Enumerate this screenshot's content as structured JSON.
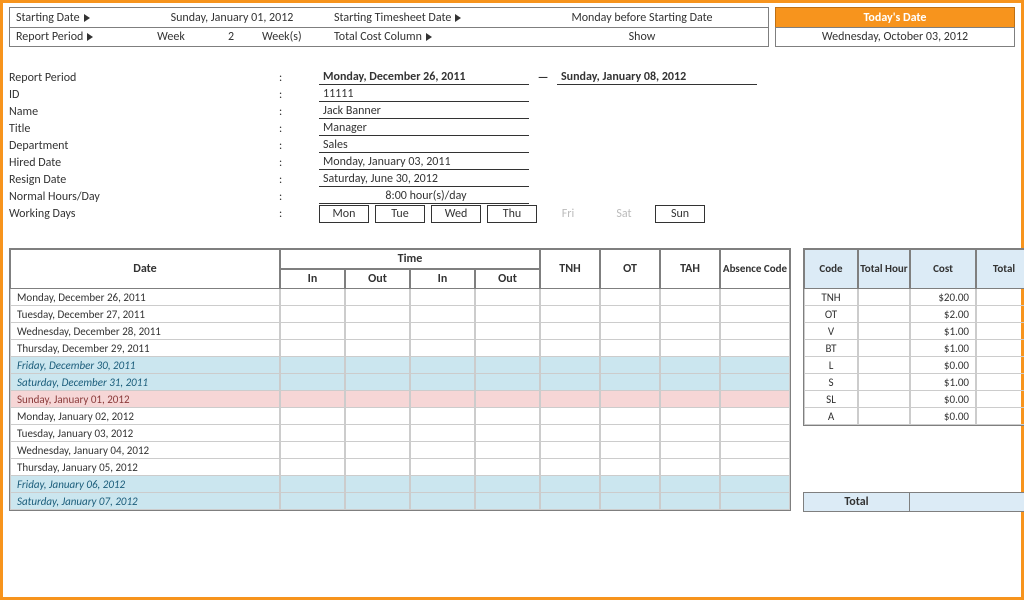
{
  "header": {
    "starting_date_label": "Starting Date",
    "starting_date_value": "Sunday, January 01, 2012",
    "ts_date_label": "Starting Timesheet Date",
    "ts_date_value": "Monday before Starting Date",
    "report_period_label": "Report Period",
    "week_label": "Week",
    "week_num": "2",
    "weeks_label": "Week(s)",
    "total_cost_label": "Total Cost Column",
    "show_label": "Show",
    "todays_date_label": "Today's Date",
    "todays_date_value": "Wednesday, October 03, 2012"
  },
  "info": {
    "report_period_label": "Report Period",
    "report_period_from": "Monday, December 26, 2011",
    "report_period_to": "Sunday, January 08, 2012",
    "id_label": "ID",
    "id_value": "11111",
    "name_label": "Name",
    "name_value": "Jack Banner",
    "title_label": "Title",
    "title_value": "Manager",
    "dept_label": "Department",
    "dept_value": "Sales",
    "hired_label": "Hired Date",
    "hired_value": "Monday, January 03, 2011",
    "resign_label": "Resign Date",
    "resign_value": "Saturday, June 30, 2012",
    "hours_label": "Normal Hours/Day",
    "hours_value": "8:00    hour(s)/day",
    "working_days_label": "Working Days",
    "days": [
      "Mon",
      "Tue",
      "Wed",
      "Thu",
      "Fri",
      "Sat",
      "Sun"
    ],
    "days_off_idx": [
      4,
      5
    ]
  },
  "timesheet": {
    "headers": {
      "date": "Date",
      "time": "Time",
      "in": "In",
      "out": "Out",
      "tnh": "TNH",
      "ot": "OT",
      "tah": "TAH",
      "absence": "Absence Code"
    },
    "rows": [
      {
        "date": "Monday, December 26, 2011",
        "cls": ""
      },
      {
        "date": "Tuesday, December 27, 2011",
        "cls": ""
      },
      {
        "date": "Wednesday, December 28, 2011",
        "cls": ""
      },
      {
        "date": "Thursday, December 29, 2011",
        "cls": ""
      },
      {
        "date": "Friday, December 30, 2011",
        "cls": "weekend"
      },
      {
        "date": "Saturday, December 31, 2011",
        "cls": "weekend"
      },
      {
        "date": "Sunday, January 01, 2012",
        "cls": "sunday"
      },
      {
        "date": "Monday, January 02, 2012",
        "cls": ""
      },
      {
        "date": "Tuesday, January 03, 2012",
        "cls": ""
      },
      {
        "date": "Wednesday, January 04, 2012",
        "cls": ""
      },
      {
        "date": "Thursday, January 05, 2012",
        "cls": ""
      },
      {
        "date": "Friday, January 06, 2012",
        "cls": "weekend"
      },
      {
        "date": "Saturday, January 07, 2012",
        "cls": "weekend"
      }
    ]
  },
  "cost": {
    "headers": {
      "code": "Code",
      "total_hour": "Total Hour",
      "cost": "Cost",
      "total": "Total"
    },
    "rows": [
      {
        "code": "TNH",
        "cost": "$20.00"
      },
      {
        "code": "OT",
        "cost": "$2.00"
      },
      {
        "code": "V",
        "cost": "$1.00"
      },
      {
        "code": "BT",
        "cost": "$1.00"
      },
      {
        "code": "L",
        "cost": "$0.00"
      },
      {
        "code": "S",
        "cost": "$1.00"
      },
      {
        "code": "SL",
        "cost": "$0.00"
      },
      {
        "code": "A",
        "cost": "$0.00"
      }
    ],
    "total_label": "Total"
  }
}
